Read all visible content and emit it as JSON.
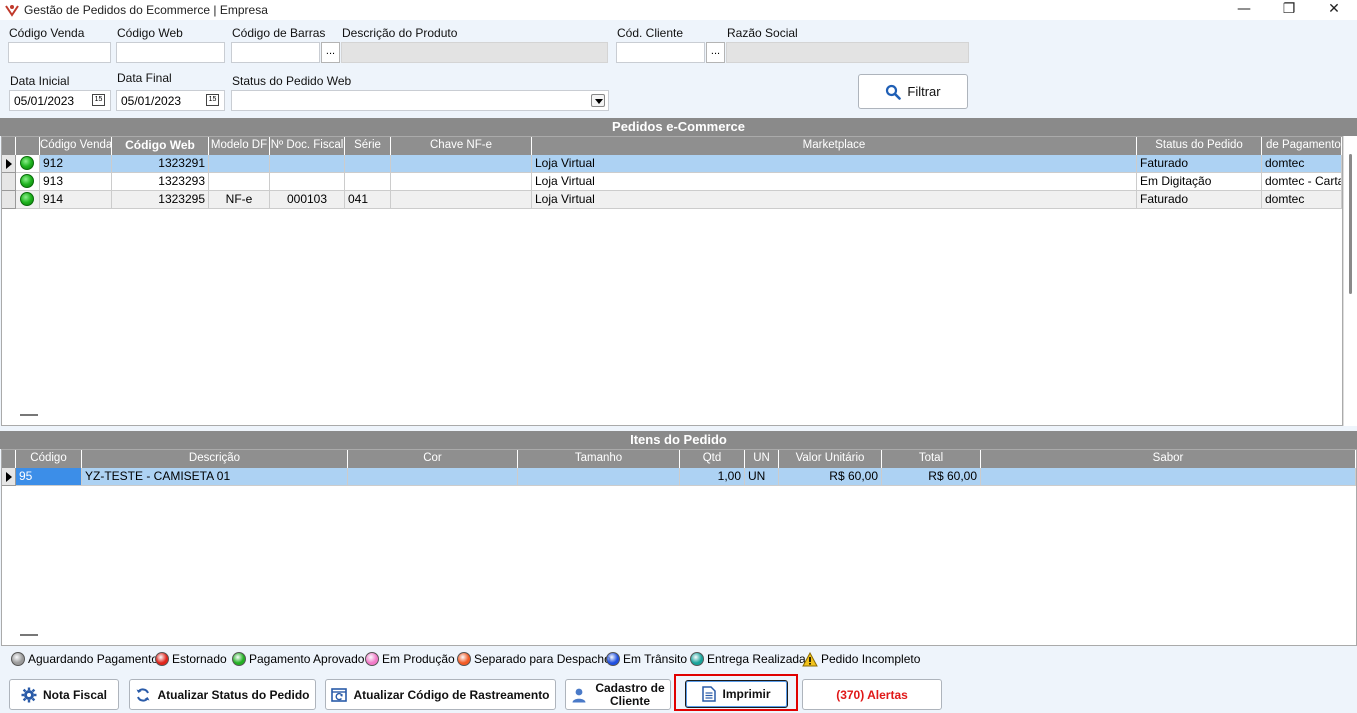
{
  "window": {
    "title": "Gestão de Pedidos do Ecommerce | Empresa",
    "min_icon": "—",
    "max_icon": "❐",
    "close_icon": "✕"
  },
  "filters": {
    "codigo_venda_label": "Código Venda",
    "codigo_venda_value": "",
    "codigo_web_label": "Código Web",
    "codigo_web_value": "",
    "codigo_barras_label": "Código de Barras",
    "codigo_barras_value": "",
    "descricao_produto_label": "Descrição do Produto",
    "descricao_produto_value": "",
    "cod_cliente_label": "Cód. Cliente",
    "cod_cliente_value": "",
    "razao_social_label": "Razão Social",
    "razao_social_value": "",
    "lookup_label": "...",
    "data_inicial_label": "Data Inicial",
    "data_inicial_value": "05/01/2023",
    "data_final_label": "Data Final",
    "data_final_value": "05/01/2023",
    "calendar_glyph": "15",
    "status_label": "Status do Pedido Web",
    "status_value": "",
    "filter_button": "Filtrar"
  },
  "orders": {
    "title": "Pedidos e-Commerce",
    "columns": [
      "Código Venda",
      "Código Web",
      "Modelo DF",
      "Nº Doc. Fiscal",
      "Série",
      "Chave NF-e",
      "Marketplace",
      "Status do Pedido",
      "de Pagamento V"
    ],
    "rows": [
      {
        "codigo_venda": "912",
        "codigo_web": "1323291",
        "modelo_df": "",
        "doc_fiscal": "",
        "serie": "",
        "chave": "",
        "marketplace": "Loja Virtual",
        "status": "Faturado",
        "pagamento": "domtec",
        "status_color": "green"
      },
      {
        "codigo_venda": "913",
        "codigo_web": "1323293",
        "modelo_df": "",
        "doc_fiscal": "",
        "serie": "",
        "chave": "",
        "marketplace": "Loja Virtual",
        "status": "Em Digitação",
        "pagamento": "domtec - Cartao",
        "status_color": "green"
      },
      {
        "codigo_venda": "914",
        "codigo_web": "1323295",
        "modelo_df": "NF-e",
        "doc_fiscal": "000103",
        "serie": "041",
        "chave": "",
        "marketplace": "Loja Virtual",
        "status": "Faturado",
        "pagamento": "domtec",
        "status_color": "green"
      }
    ]
  },
  "items": {
    "title": "Itens do Pedido",
    "columns": [
      "Código",
      "Descrição",
      "Cor",
      "Tamanho",
      "Qtd",
      "UN",
      "Valor Unitário",
      "Total",
      "Sabor"
    ],
    "rows": [
      {
        "codigo": "95",
        "descricao": "YZ-TESTE - CAMISETA 01",
        "cor": "",
        "tamanho": "",
        "qtd": "1,00",
        "un": "UN",
        "valor_unitario": "R$ 60,00",
        "total": "R$ 60,00",
        "sabor": ""
      }
    ]
  },
  "legend": [
    {
      "label": "Aguardando Pagamento",
      "color": "#9a9a9a"
    },
    {
      "label": "Estornado",
      "color": "#e0241b"
    },
    {
      "label": "Pagamento Aprovado",
      "color": "#22b022"
    },
    {
      "label": "Em Produção",
      "color": "#f27ac8"
    },
    {
      "label": "Separado para Despacho",
      "color": "#f35a24"
    },
    {
      "label": "Em Trânsito",
      "color": "#1f4fe0"
    },
    {
      "label": "Entrega Realizada",
      "color": "#17a39a"
    },
    {
      "label": "Pedido Incompleto",
      "color": "#f2c21a"
    }
  ],
  "footer": {
    "nota_fiscal": "Nota Fiscal",
    "atualizar_status": "Atualizar Status do Pedido",
    "atualizar_rastreamento": "Atualizar Código de Rastreamento",
    "cadastro_cliente_1": "Cadastro de",
    "cadastro_cliente_2": "Cliente",
    "imprimir": "Imprimir",
    "alertas": "(370) Alertas",
    "highlight_color": "#e00000"
  }
}
